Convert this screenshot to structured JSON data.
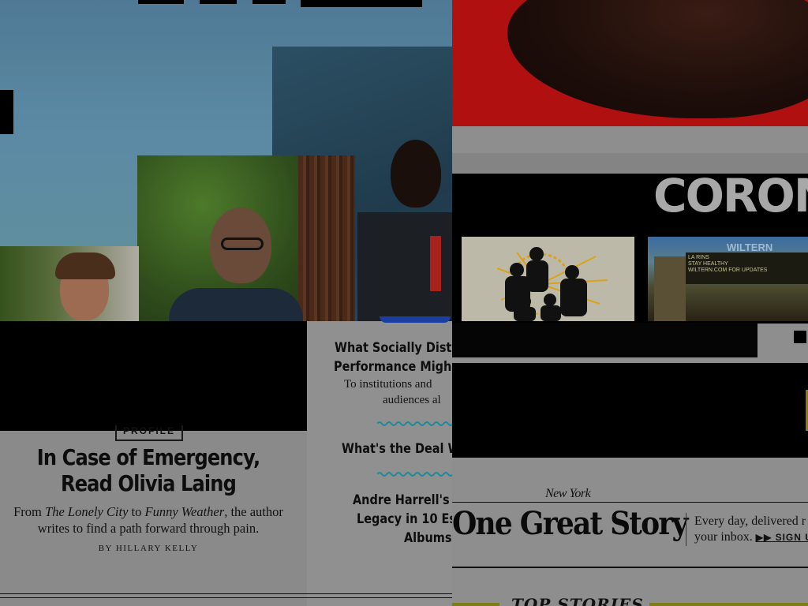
{
  "left_story": {
    "kicker": "PROFILE",
    "title": "In Case of Emergency, Read Olivia Laing",
    "dek_prefix": "From ",
    "dek_book1": "The Lonely City",
    "dek_mid": " to ",
    "dek_book2": "Funny Weather",
    "dek_suffix": ", the author writes to find a path forward through pain.",
    "byline": "BY HILLARY KELLY"
  },
  "side_stories": [
    {
      "title_line1": "What Socially Dist",
      "title_line2": "Performance Migh",
      "dek_line1": "To institutions and",
      "dek_line2": "audiences al"
    },
    {
      "title_line1": "What's the Deal W"
    },
    {
      "title_line1": "Andre Harrell's",
      "title_line2": "Legacy in 10 Es",
      "title_line3": "Albums"
    }
  ],
  "feature": {
    "headline": "CORON"
  },
  "theater": {
    "sign": "WILTERN",
    "marquee_lines": [
      "LA RINS",
      "STAY HEALTHY",
      "WILTERN.COM FOR UPDATES"
    ]
  },
  "newsletter": {
    "brand": "New York",
    "title": "One Great Story",
    "text_line1": "Every day, delivered r",
    "text_line2": "your inbox.",
    "signup": "SIGN U"
  },
  "section": {
    "label": "TOP STORIES"
  },
  "colors": {
    "accent_squiggle": "#1e8a9a",
    "red_photo": "#b01010",
    "page_bg": "#8f8f8f"
  },
  "icons": {
    "signup_arrow": "double-arrow-icon"
  }
}
